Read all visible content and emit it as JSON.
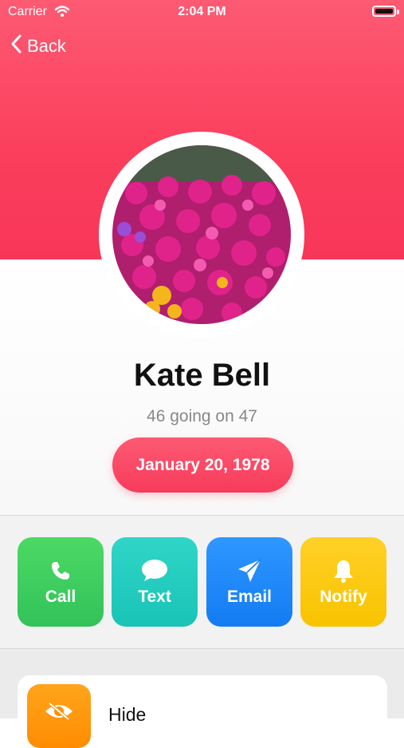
{
  "status_bar": {
    "carrier": "Carrier",
    "time": "2:04 PM"
  },
  "nav": {
    "back_label": "Back"
  },
  "profile": {
    "name": "Kate Bell",
    "age_text": "46 going on 47",
    "birthday": "January 20, 1978",
    "avatar": "flower-photo"
  },
  "actions": [
    {
      "label": "Call",
      "icon": "phone-icon",
      "color": "#4cd964"
    },
    {
      "label": "Text",
      "icon": "message-icon",
      "color": "#2fd6c8"
    },
    {
      "label": "Email",
      "icon": "paper-plane-icon",
      "color": "#2f97ff"
    },
    {
      "label": "Notify",
      "icon": "bell-icon",
      "color": "#ffd027"
    }
  ],
  "options": [
    {
      "label": "Hide",
      "icon": "eye-slash-icon",
      "color": "#ff9f0a"
    }
  ],
  "colors": {
    "accent": "#fb3e5c"
  }
}
